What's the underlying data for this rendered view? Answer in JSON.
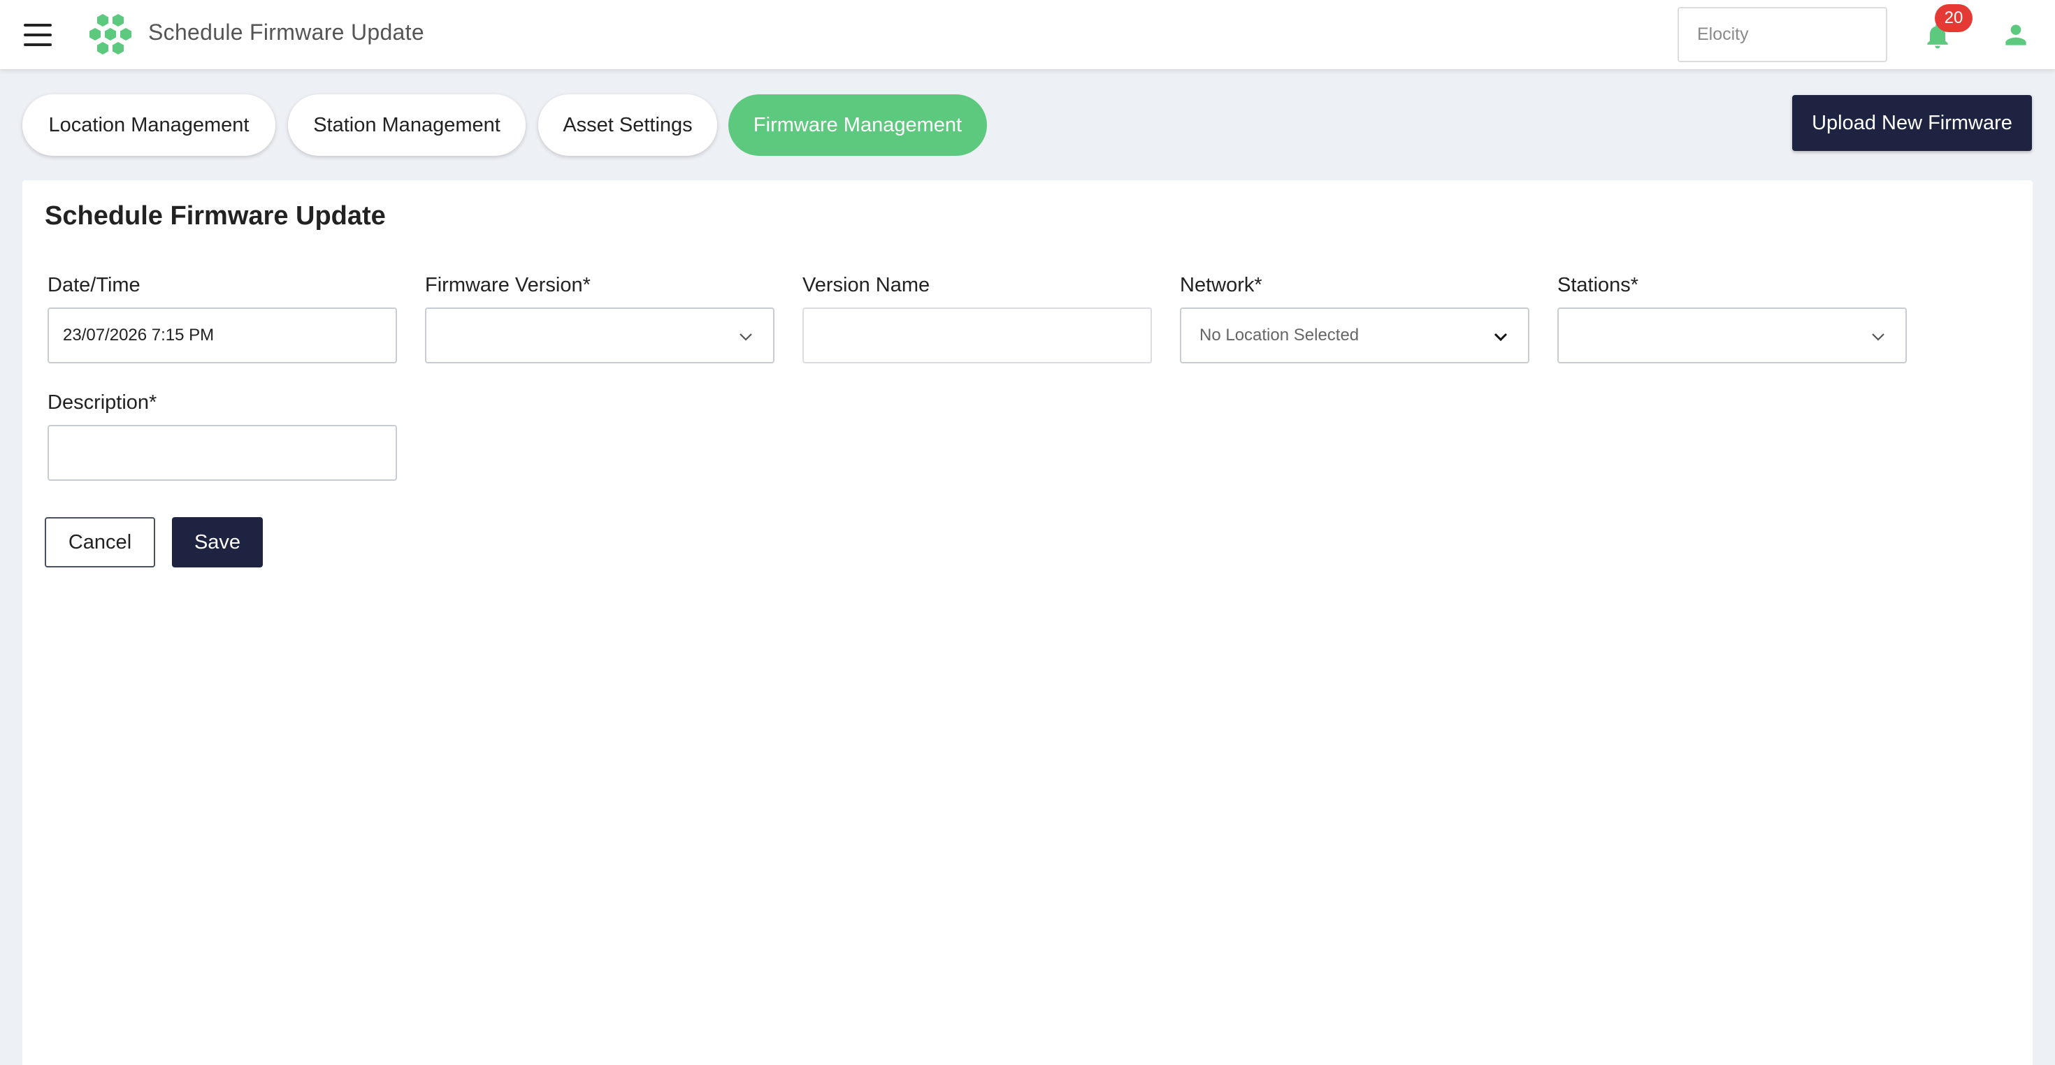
{
  "header": {
    "title": "Schedule Firmware Update",
    "org_placeholder": "Elocity",
    "notification_count": "20",
    "colors": {
      "brand_green": "#5dc97e",
      "dark": "#1d2340",
      "badge": "#e53935"
    }
  },
  "tabs": [
    {
      "label": "Location Management",
      "active": false
    },
    {
      "label": "Station Management",
      "active": false
    },
    {
      "label": "Asset Settings",
      "active": false
    },
    {
      "label": "Firmware Management",
      "active": true
    }
  ],
  "actions": {
    "upload_label": "Upload New Firmware"
  },
  "form": {
    "title": "Schedule Firmware Update",
    "datetime": {
      "label": "Date/Time",
      "value": "23/07/2026 7:15 PM"
    },
    "firmware_version": {
      "label": "Firmware Version*",
      "value": ""
    },
    "version_name": {
      "label": "Version Name",
      "value": ""
    },
    "network": {
      "label": "Network*",
      "value": "No Location Selected"
    },
    "stations": {
      "label": "Stations*",
      "value": ""
    },
    "description": {
      "label": "Description*",
      "value": ""
    },
    "cancel_label": "Cancel",
    "save_label": "Save"
  }
}
